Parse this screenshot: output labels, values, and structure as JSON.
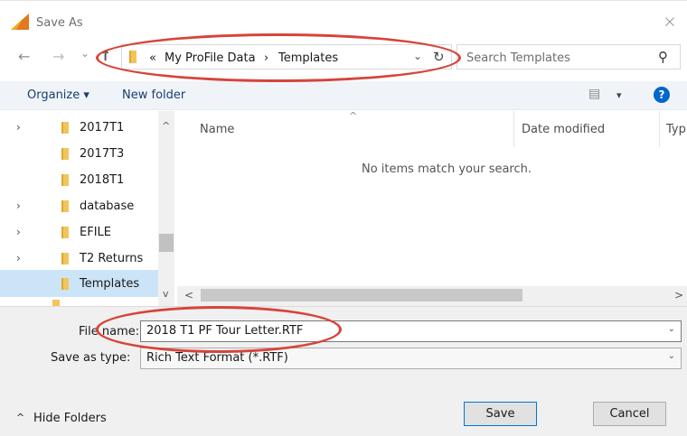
{
  "window": {
    "title": "Save As",
    "close_glyph": "×",
    "app_icon": "profile-app-icon",
    "close_icon": "close-icon"
  },
  "nav": {
    "back_glyph": "←",
    "forward_glyph": "→",
    "recent_glyph": "⌄",
    "up_glyph": "↑"
  },
  "address": {
    "overflow_glyph": "«",
    "crumbs": [
      "My ProFile Data",
      "Templates"
    ],
    "separator": "›",
    "dropdown_glyph": "⌄",
    "refresh_glyph": "↻"
  },
  "search": {
    "placeholder": "Search Templates",
    "icon_glyph": "⚲"
  },
  "toolbar": {
    "organize_label": "Organize ▾",
    "new_folder_label": "New folder",
    "view_icon_glyph": "▤",
    "view_dropdown_glyph": "▾",
    "help_glyph": "?"
  },
  "tree": {
    "items": [
      {
        "label": "2017T1",
        "arrow": "›",
        "selected": false
      },
      {
        "label": "2017T3",
        "arrow": "",
        "selected": false
      },
      {
        "label": "2018T1",
        "arrow": "",
        "selected": false
      },
      {
        "label": "database",
        "arrow": "›",
        "selected": false
      },
      {
        "label": "EFILE",
        "arrow": "›",
        "selected": false
      },
      {
        "label": "T2 Returns",
        "arrow": "›",
        "selected": false
      },
      {
        "label": "Templates",
        "arrow": "",
        "selected": true
      }
    ],
    "scroll_up_glyph": "^",
    "scroll_down_glyph": "v"
  },
  "content": {
    "columns": [
      "Name",
      "Date modified",
      "Typ"
    ],
    "sort_glyph": "^",
    "empty_message": "No items match your search.",
    "hscroll_left_glyph": "<",
    "hscroll_right_glyph": ">"
  },
  "form": {
    "file_name_label": "File name:",
    "file_name_value": "2018 T1 PF Tour Letter.RTF",
    "save_type_label": "Save as type:",
    "save_type_value": "Rich Text Format (*.RTF)",
    "dropdown_glyph": "⌄"
  },
  "footer": {
    "hide_folders_label": "Hide Folders",
    "hide_folders_glyph": "^",
    "save_label": "Save",
    "cancel_label": "Cancel"
  },
  "colors": {
    "annotation": "#d6443a",
    "selection": "#cce4f7",
    "folder": "#f2c55c",
    "help": "#0066cc"
  }
}
